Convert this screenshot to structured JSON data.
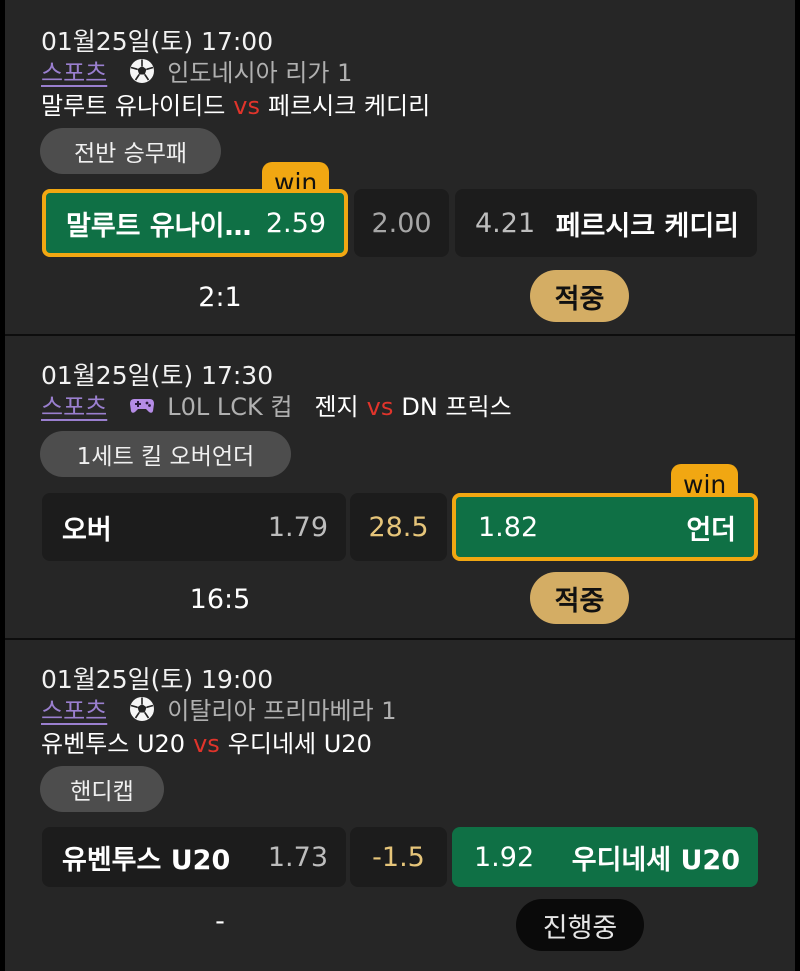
{
  "bets": [
    {
      "datetime": "01월25일(토) 17:00",
      "category": "스포츠",
      "league_icon": "soccer-ball-icon",
      "league": "인도네시아 리가 1",
      "home": "말루트 유나이티드",
      "vs": "vs",
      "away": "페르시크 케디리",
      "market": "전반 승무패",
      "option_left_name": "말루트 유나이…",
      "option_left_odds": "2.59",
      "option_mid": "2.00",
      "option_right_odds": "4.21",
      "option_right_name": "페르시크 케디리",
      "win_badge": "win",
      "winner_side": "left",
      "score": "2:1",
      "status": "적중"
    },
    {
      "datetime": "01월25일(토) 17:30",
      "category": "스포츠",
      "league_icon": "gamepad-icon",
      "league": "L0L LCK 컵",
      "home": "젠지",
      "vs": "vs",
      "away": "DN 프릭스",
      "market": "1세트 킬 오버언더",
      "option_left_name": "오버",
      "option_left_odds": "1.79",
      "option_mid": "28.5",
      "option_right_odds": "1.82",
      "option_right_name": "언더",
      "win_badge": "win",
      "winner_side": "right",
      "score": "16:5",
      "status": "적중"
    },
    {
      "datetime": "01월25일(토) 19:00",
      "category": "스포츠",
      "league_icon": "soccer-ball-icon",
      "league": "이탈리아 프리마베라 1",
      "home": "유벤투스 U20",
      "vs": "vs",
      "away": "우디네세 U20",
      "market": "핸디캡",
      "option_left_name": "유벤투스 U20",
      "option_left_odds": "1.73",
      "option_mid": "-1.5",
      "option_right_odds": "1.92",
      "option_right_name": "우디네세 U20",
      "selected_side": "right",
      "score": "-",
      "status": "진행중"
    }
  ],
  "colors": {
    "accent_green": "#0f7045",
    "win_gold": "#f1a712",
    "hit_gold": "#d4ad64",
    "vs_red": "#e0342b",
    "category_purple": "#9a7fcf"
  }
}
